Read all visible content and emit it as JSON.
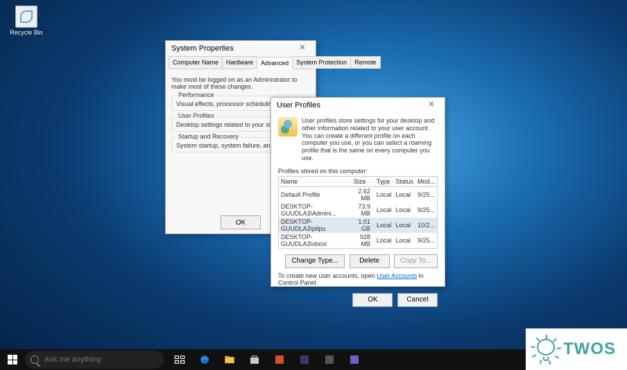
{
  "desktop": {
    "recycle_bin": "Recycle Bin"
  },
  "sysprops": {
    "title": "System Properties",
    "tabs": [
      "Computer Name",
      "Hardware",
      "Advanced",
      "System Protection",
      "Remote"
    ],
    "active_tab": 2,
    "note": "You must be logged on as an Administrator to make most of these changes.",
    "groups": {
      "perf_legend": "Performance",
      "perf_text": "Visual effects, processor scheduling, memo",
      "up_legend": "User Profiles",
      "up_text": "Desktop settings related to your sign-in",
      "sr_legend": "Startup and Recovery",
      "sr_text": "System startup, system failure, and debuggi"
    },
    "ok": "OK"
  },
  "profiles": {
    "title": "User Profiles",
    "intro": "User profiles store settings for your desktop and other information related to your user account. You can create a different profile on each computer you use, or you can select a roaming profile that is the same on every computer you use.",
    "table_label": "Profiles stored on this computer:",
    "columns": [
      "Name",
      "Size",
      "Type",
      "Status",
      "Mod..."
    ],
    "rows": [
      {
        "name": "Default Profile",
        "size": "2.62 MB",
        "type": "Local",
        "status": "Local",
        "mod": "9/25..."
      },
      {
        "name": "DESKTOP-GUUDLA3\\Admini...",
        "size": "73.9 MB",
        "type": "Local",
        "status": "Local",
        "mod": "9/25..."
      },
      {
        "name": "DESKTOP-GUUDLA3\\pitpu",
        "size": "1.01 GB",
        "type": "Local",
        "status": "Local",
        "mod": "10/2..."
      },
      {
        "name": "DESKTOP-GUUDLA3\\xboxl",
        "size": "928 MB",
        "type": "Local",
        "status": "Local",
        "mod": "9/25..."
      }
    ],
    "selected_row": 2,
    "buttons": {
      "change_type": "Change Type...",
      "delete": "Delete",
      "copy_to": "Copy To..."
    },
    "link_prefix": "To create new user accounts, open ",
    "link_text": "User Accounts",
    "link_suffix": " in Control Panel.",
    "ok": "OK",
    "cancel": "Cancel"
  },
  "taskbar": {
    "search_placeholder": "Ask me anything"
  },
  "twos": {
    "text": "TWOS"
  }
}
